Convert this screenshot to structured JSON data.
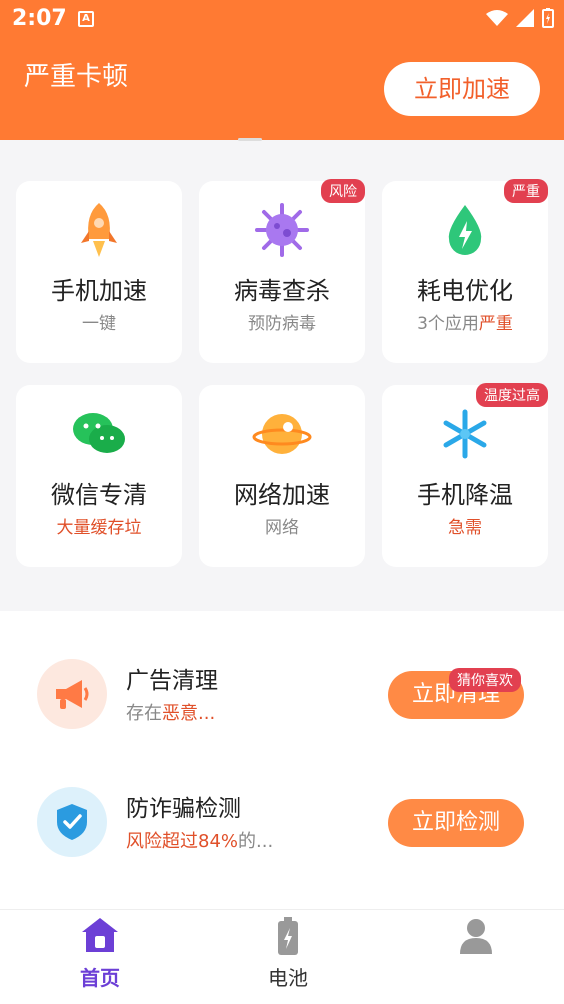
{
  "status": {
    "time": "2:07",
    "notif": "A"
  },
  "header": {
    "title": "严重卡顿",
    "action": "立即加速"
  },
  "grid": [
    {
      "title": "手机加速",
      "subtitle": "一键",
      "icon": "rocket-icon"
    },
    {
      "title": "病毒查杀",
      "subtitle": "预防病毒",
      "badge": "风险",
      "icon": "virus-icon"
    },
    {
      "title": "耗电优化",
      "subtitle_a": "3个应用",
      "subtitle_b": "严重",
      "badge": "严重",
      "icon": "battery-drop-icon"
    },
    {
      "title": "微信专清",
      "subtitle": "大量缓存垃",
      "icon": "wechat-icon"
    },
    {
      "title": "网络加速",
      "subtitle": "网络",
      "icon": "planet-icon"
    },
    {
      "title": "手机降温",
      "subtitle": "急需",
      "badge": "温度过高",
      "icon": "snowflake-icon"
    }
  ],
  "list": [
    {
      "title": "广告清理",
      "sub_a": "存在",
      "sub_b": "恶意...",
      "action": "立即清理",
      "tag": "猜你喜欢",
      "icon": "megaphone-icon"
    },
    {
      "title": "防诈骗检测",
      "sub_a": "风险超过84%",
      "sub_b": "的...",
      "action": "立即检测",
      "icon": "shield-check-icon"
    }
  ],
  "tabs": [
    {
      "label": "首页",
      "icon": "home-icon",
      "active": true
    },
    {
      "label": "电池",
      "icon": "battery-icon",
      "active": false
    },
    {
      "label": "",
      "icon": "profile-icon",
      "active": false
    }
  ],
  "colors": {
    "accent": "#ff7a33",
    "tab_active": "#6c3fd6",
    "badge": "#e24050"
  }
}
